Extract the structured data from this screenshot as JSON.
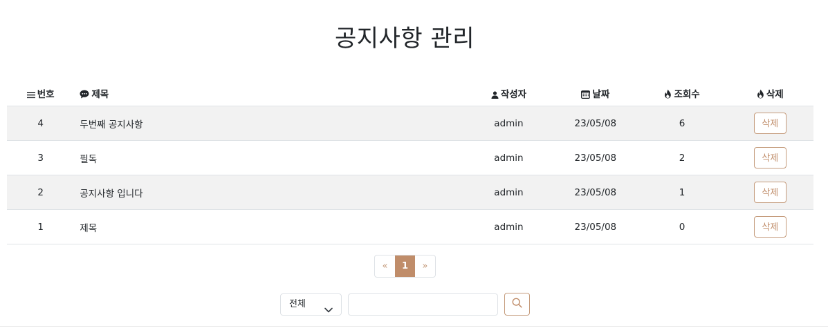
{
  "page": {
    "title": "공지사항 관리"
  },
  "table": {
    "headers": {
      "number": "번호",
      "title": "제목",
      "author": "작성자",
      "date": "날짜",
      "views": "조회수",
      "delete": "삭제"
    },
    "header_icons": {
      "number": "list-icon",
      "title": "chat-bubble-icon",
      "author": "person-icon",
      "date": "calendar-icon",
      "views": "fire-icon",
      "delete": "fire-icon"
    },
    "rows": [
      {
        "number": "4",
        "title": "두번째 공지사항",
        "author": "admin",
        "date": "23/05/08",
        "views": "6",
        "delete_label": "삭제"
      },
      {
        "number": "3",
        "title": "필독",
        "author": "admin",
        "date": "23/05/08",
        "views": "2",
        "delete_label": "삭제"
      },
      {
        "number": "2",
        "title": "공지사항 입니다",
        "author": "admin",
        "date": "23/05/08",
        "views": "1",
        "delete_label": "삭제"
      },
      {
        "number": "1",
        "title": "제목",
        "author": "admin",
        "date": "23/05/08",
        "views": "0",
        "delete_label": "삭제"
      }
    ]
  },
  "pagination": {
    "prev": "«",
    "current": "1",
    "next": "»"
  },
  "search": {
    "select_value": "전체",
    "input_value": "",
    "button_icon": "search-icon"
  },
  "colors": {
    "accent": "#c08d6a",
    "stripe": "#f2f2f2"
  }
}
